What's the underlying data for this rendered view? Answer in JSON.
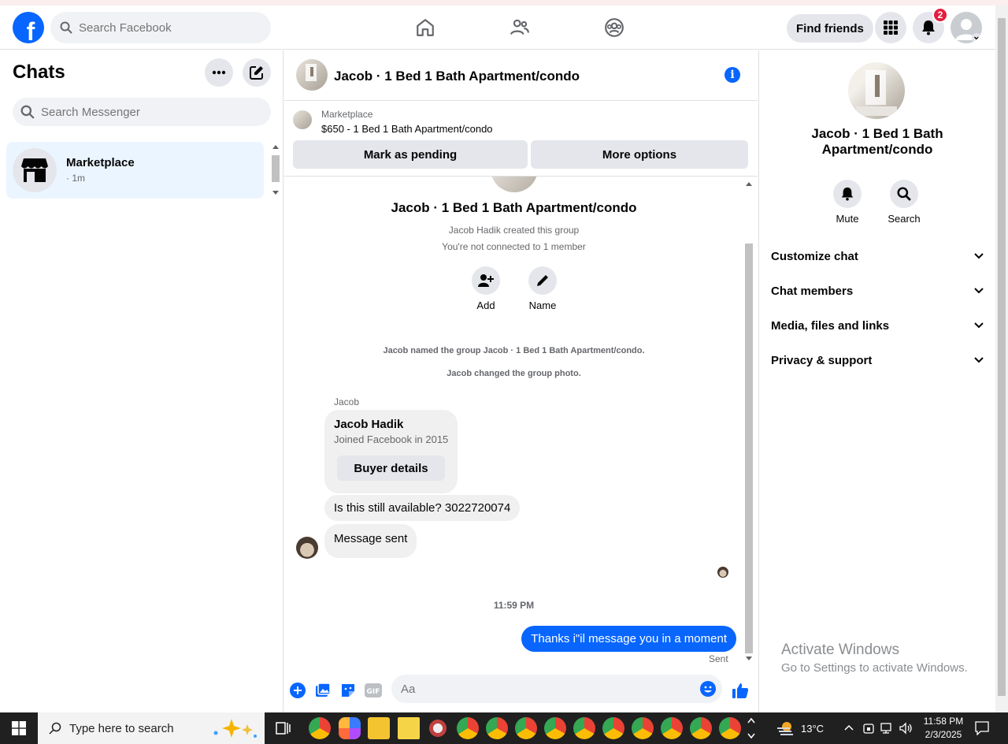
{
  "nav": {
    "search_placeholder": "Search Facebook",
    "find_friends": "Find friends",
    "notification_count": "2"
  },
  "left": {
    "title": "Chats",
    "search_placeholder": "Search Messenger",
    "chats": [
      {
        "name": "Marketplace",
        "time": "· 1m"
      }
    ]
  },
  "chat": {
    "title": "Jacob · 1 Bed 1 Bath Apartment/condo",
    "marketplace_label": "Marketplace",
    "listing": "$650 - 1 Bed 1 Bath Apartment/condo",
    "mark_pending": "Mark as pending",
    "more_options": "More options",
    "group_title": "Jacob · 1 Bed 1 Bath Apartment/condo",
    "created": "Jacob Hadik created this group",
    "not_connected": "You're not connected to 1 member",
    "add_label": "Add",
    "name_label": "Name",
    "event_named": "Jacob named the group Jacob · 1 Bed 1 Bath Apartment/condo.",
    "event_photo": "Jacob changed the group photo.",
    "sender": "Jacob",
    "card_name": "Jacob Hadik",
    "card_joined": "Joined Facebook in 2015",
    "card_button": "Buyer details",
    "msg1": "Is this still available? 3022720074",
    "msg2": "Message sent",
    "time_sep": "11:59 PM",
    "msg_out": "Thanks i\"il message you in a moment",
    "sent_status": "Sent",
    "composer_placeholder": "Aa"
  },
  "right": {
    "title": "Jacob · 1 Bed 1 Bath Apartment/condo",
    "mute": "Mute",
    "search": "Search",
    "sections": [
      "Customize chat",
      "Chat members",
      "Media, files and links",
      "Privacy & support"
    ],
    "watermark_title": "Activate Windows",
    "watermark_sub": "Go to Settings to activate Windows."
  },
  "taskbar": {
    "search_placeholder": "Type here to search",
    "temperature": "13°C",
    "time": "11:58 PM",
    "date": "2/3/2025"
  },
  "colors": {
    "accent": "#0866ff",
    "badge": "#e41e3f",
    "bubble": "#f0f0f0"
  }
}
